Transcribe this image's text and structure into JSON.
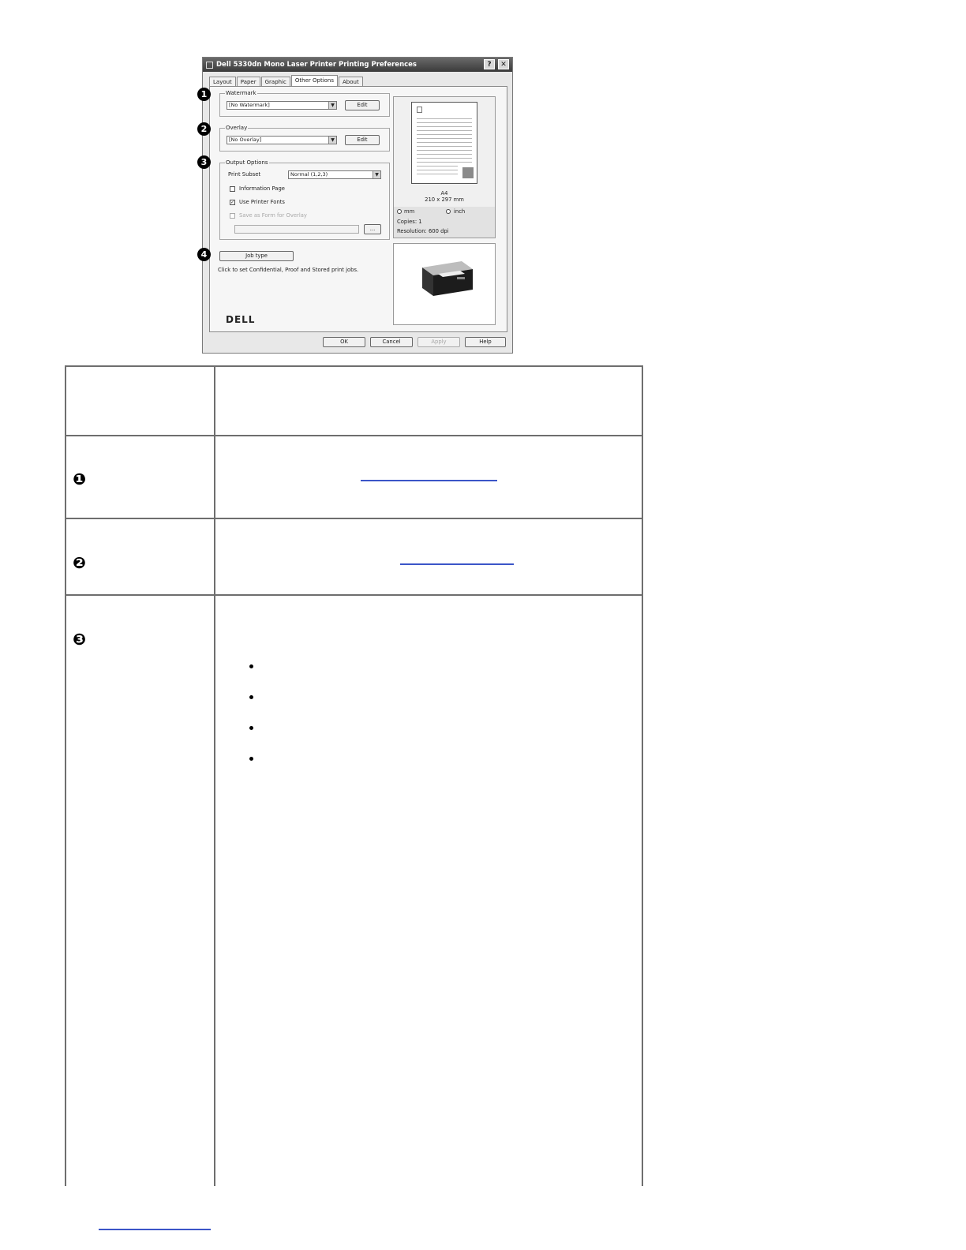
{
  "dialog": {
    "title": "Dell 5330dn Mono Laser Printer Printing Preferences",
    "help_label": "?",
    "close_label": "✕",
    "tabs": [
      "Layout",
      "Paper",
      "Graphic",
      "Other Options",
      "About"
    ],
    "watermark": {
      "legend": "Watermark",
      "value": "[No Watermark]",
      "edit_label": "Edit"
    },
    "overlay": {
      "legend": "Overlay",
      "value": "[No Overlay]",
      "edit_label": "Edit"
    },
    "output_options": {
      "legend": "Output Options",
      "print_subset_label": "Print Subset",
      "print_subset_value": "Normal (1,2,3)",
      "information_page_label": "Information Page",
      "use_printer_fonts_label": "Use Printer Fonts",
      "save_as_form_label": "Save as Form for Overlay",
      "browse_label": "..."
    },
    "job_type": {
      "button_label": "Job type",
      "description": "Click to set Confidential, Proof and Stored print jobs."
    },
    "logo": "DELL",
    "preview": {
      "paper_name": "A4",
      "paper_size": "210 x 297 mm",
      "unit_mm": "mm",
      "unit_inch": "inch",
      "copies": "Copies: 1",
      "resolution": "Resolution: 600 dpi"
    },
    "footer": {
      "ok": "OK",
      "cancel": "Cancel",
      "apply": "Apply",
      "help": "Help"
    },
    "callouts": [
      "1",
      "2",
      "3",
      "4"
    ]
  },
  "table": {
    "row_markers": [
      "❶",
      "❷",
      "❸"
    ]
  }
}
